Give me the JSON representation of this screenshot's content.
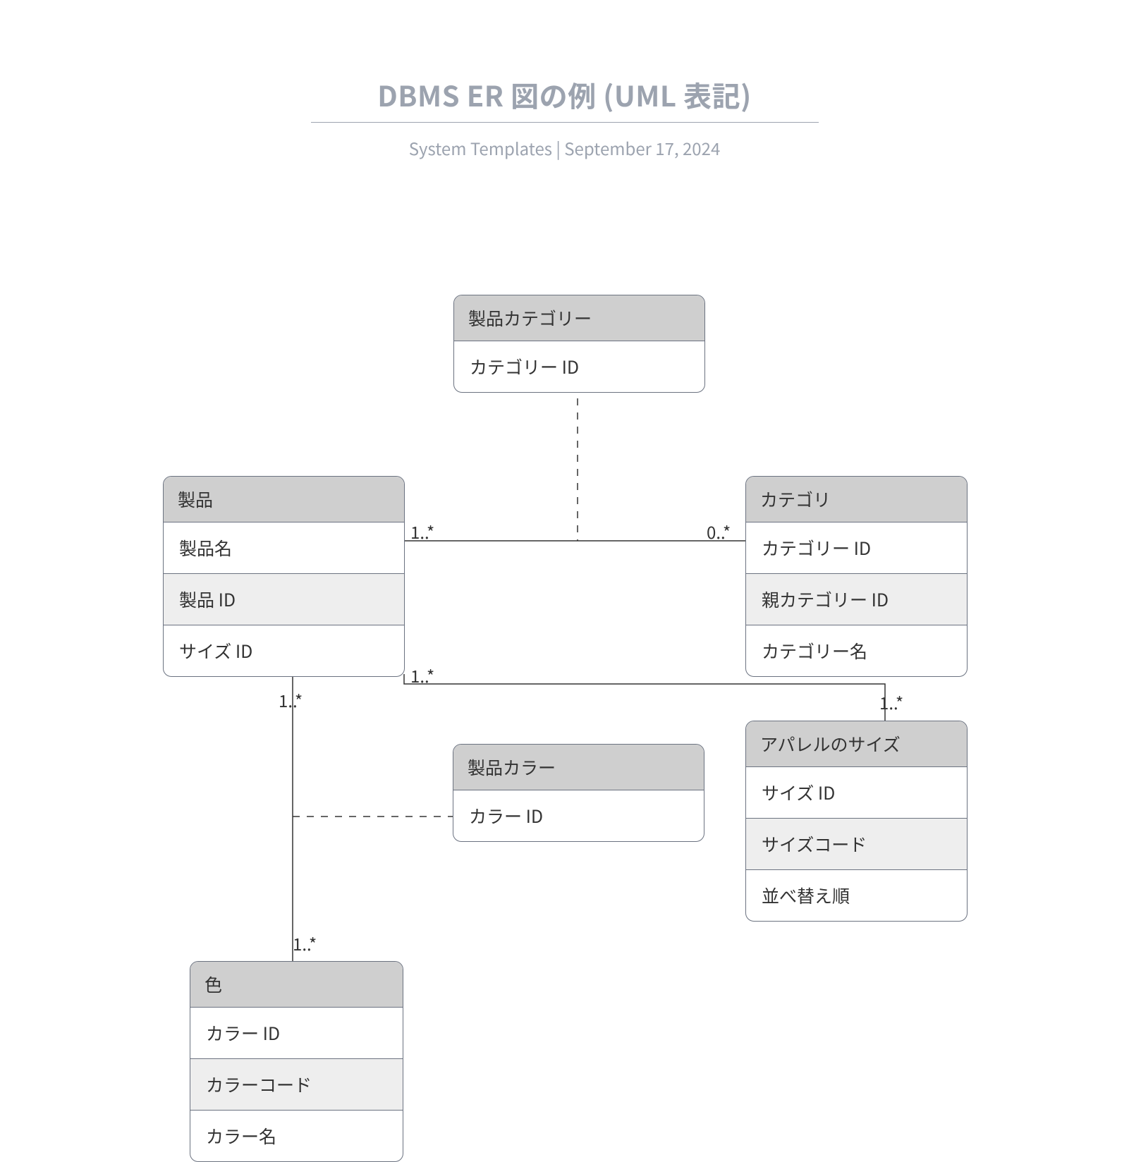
{
  "header": {
    "title": "DBMS ER 図の例 (UML 表記)",
    "subtitle_author": "System Templates",
    "subtitle_sep": "  |  ",
    "subtitle_date": "September 17, 2024"
  },
  "entities": {
    "product_category": {
      "title": "製品カテゴリー",
      "rows": [
        "カテゴリー ID"
      ]
    },
    "product": {
      "title": "製品",
      "rows": [
        "製品名",
        "製品 ID",
        "サイズ ID"
      ]
    },
    "category": {
      "title": "カテゴリ",
      "rows": [
        "カテゴリー ID",
        "親カテゴリー ID",
        "カテゴリー名"
      ]
    },
    "product_color": {
      "title": "製品カラー",
      "rows": [
        "カラー ID"
      ]
    },
    "apparel_size": {
      "title": "アパレルのサイズ",
      "rows": [
        "サイズ ID",
        "サイズコード",
        "並べ替え順"
      ]
    },
    "color": {
      "title": "色",
      "rows": [
        "カラー ID",
        "カラーコード",
        "カラー名"
      ]
    }
  },
  "multiplicities": {
    "prod_cat_left": "1..*",
    "prod_cat_right": "0..*",
    "prod_size_left": "1..*",
    "prod_size_right": "1..*",
    "prod_color_top": "1..*",
    "prod_color_bottom": "1..*"
  }
}
